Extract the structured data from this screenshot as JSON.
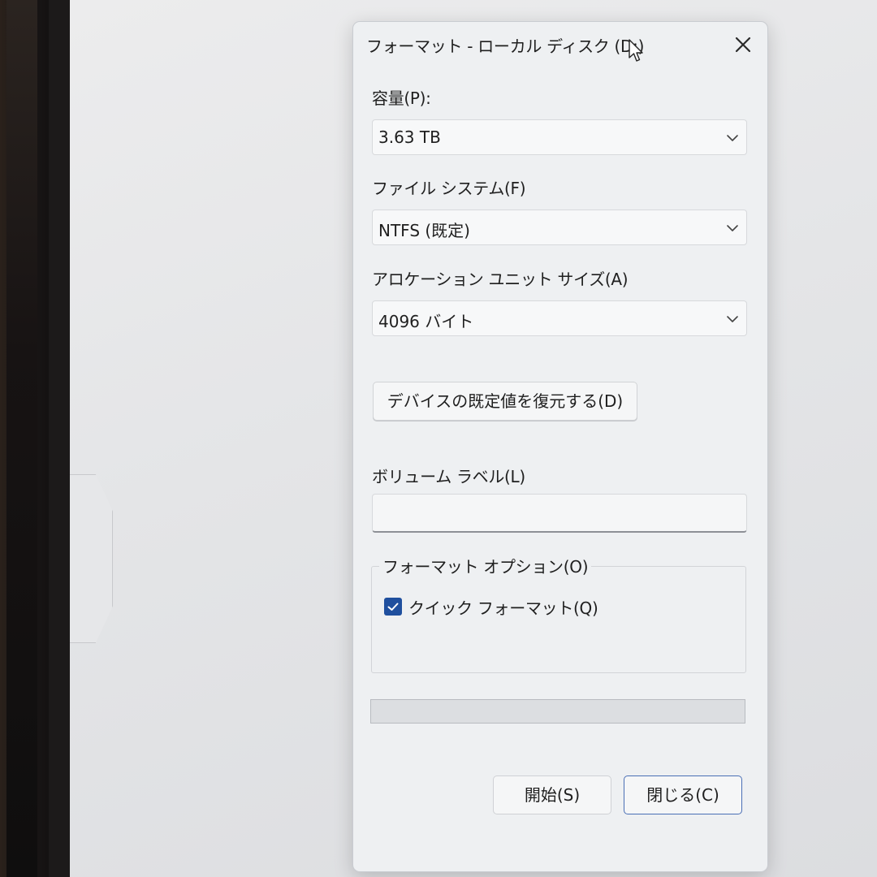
{
  "dialog": {
    "title": "フォーマット - ローカル ディスク (D:)"
  },
  "capacity": {
    "label": "容量(P):",
    "value": "3.63 TB"
  },
  "file_system": {
    "label": "ファイル システム(F)",
    "value": "NTFS (既定)"
  },
  "allocation_unit": {
    "label": "アロケーション ユニット サイズ(A)",
    "value": "4096 バイト"
  },
  "restore_defaults_label": "デバイスの既定値を復元する(D)",
  "volume_label": {
    "label": "ボリューム ラベル(L)",
    "value": ""
  },
  "format_options": {
    "legend": "フォーマット オプション(O)",
    "quick_format_label": "クイック フォーマット(Q)",
    "quick_format_checked": true
  },
  "progress": {
    "value": 0
  },
  "buttons": {
    "start": "開始(S)",
    "close": "閉じる(C)"
  },
  "colors": {
    "checkbox_accent": "#1f4f9e",
    "close_button_border": "#4a6fb5"
  },
  "icons": [
    "close-icon",
    "chevron-down-icon",
    "checkmark-icon",
    "mouse-cursor-icon"
  ]
}
